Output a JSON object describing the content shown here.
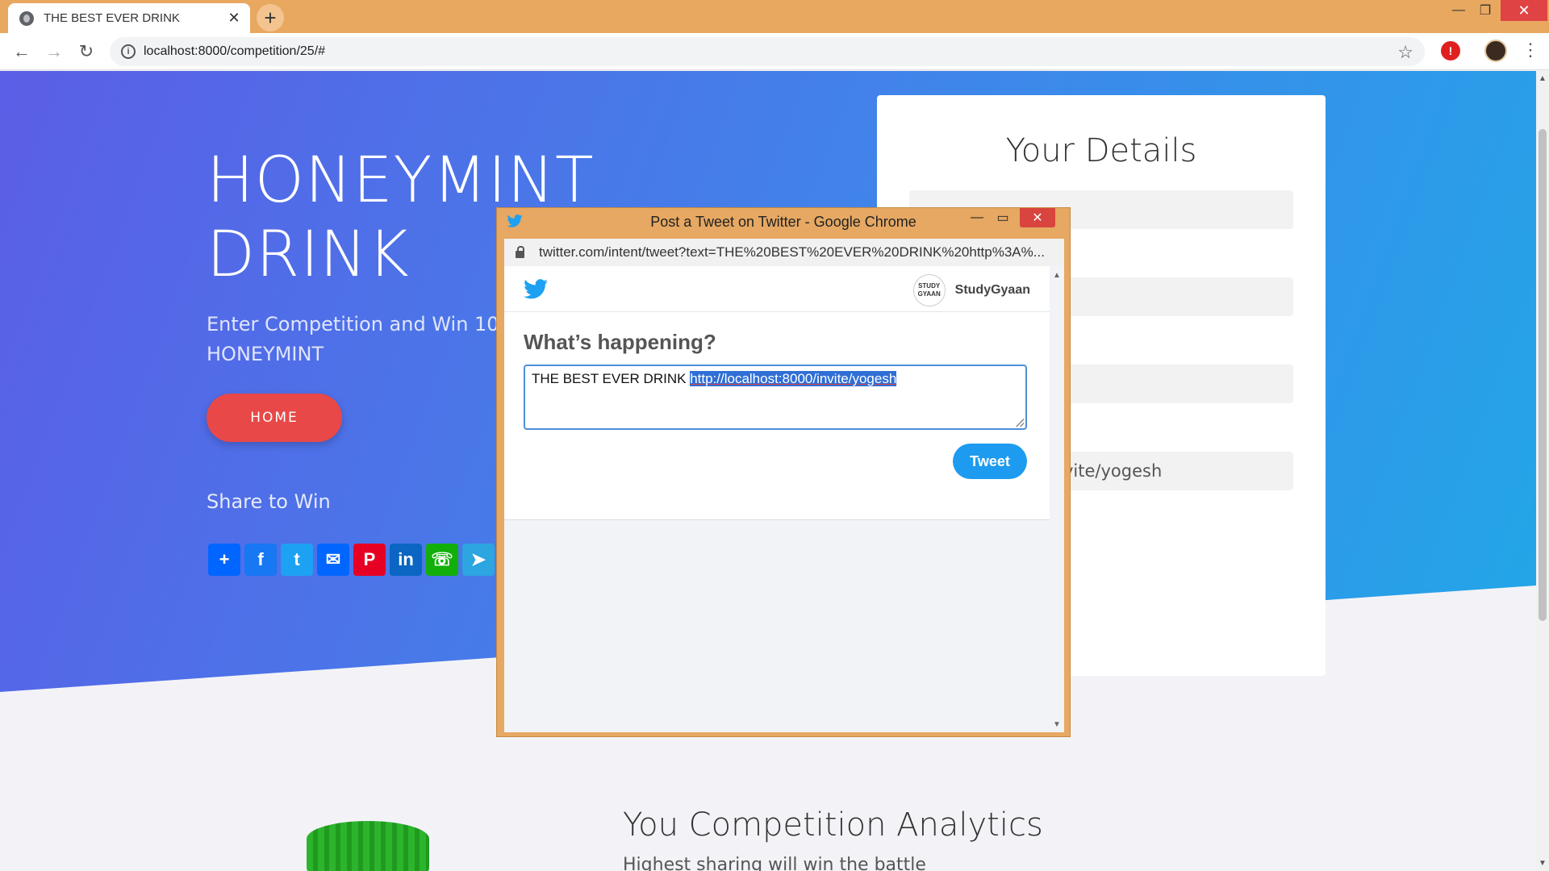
{
  "browser": {
    "tab_title": "THE BEST EVER DRINK",
    "url": "localhost:8000/competition/25/#"
  },
  "hero": {
    "title_line1": "HONEYMINT",
    "title_line2": "DRINK",
    "subtitle_line1": "Enter Competition and Win 10",
    "subtitle_line2": "HONEYMINT",
    "home_label": "HOME",
    "share_heading": "Share to Win",
    "share_icons": [
      {
        "name": "addtoany",
        "glyph": "+",
        "color": "#0166ff"
      },
      {
        "name": "facebook",
        "glyph": "f",
        "color": "#1877f2"
      },
      {
        "name": "twitter",
        "glyph": "t",
        "color": "#1da1f2"
      },
      {
        "name": "email",
        "glyph": "✉",
        "color": "#0166ff"
      },
      {
        "name": "pinterest",
        "glyph": "P",
        "color": "#e60023"
      },
      {
        "name": "linkedin",
        "glyph": "in",
        "color": "#0a66c2"
      },
      {
        "name": "whatsapp",
        "glyph": "☏",
        "color": "#12af0a"
      },
      {
        "name": "telegram",
        "glyph": "➤",
        "color": "#2ca5e0"
      }
    ]
  },
  "details": {
    "title": "Your Details",
    "invite_value": "localhost:8000/invite/yogesh"
  },
  "analytics": {
    "title": "You Competition Analytics",
    "subtitle": "Highest sharing will win the battle"
  },
  "popup": {
    "window_title": "Post a Tweet on Twitter - Google Chrome",
    "url": "twitter.com/intent/tweet?text=THE%20BEST%20EVER%20DRINK%20http%3A%...",
    "account_name": "StudyGyaan",
    "account_avatar_text": "STUDY GYAAN",
    "prompt": "What’s happening?",
    "tweet_text": "THE BEST EVER DRINK ",
    "tweet_url": "http://localhost:8000/invite/yogesh",
    "tweet_button": "Tweet"
  }
}
